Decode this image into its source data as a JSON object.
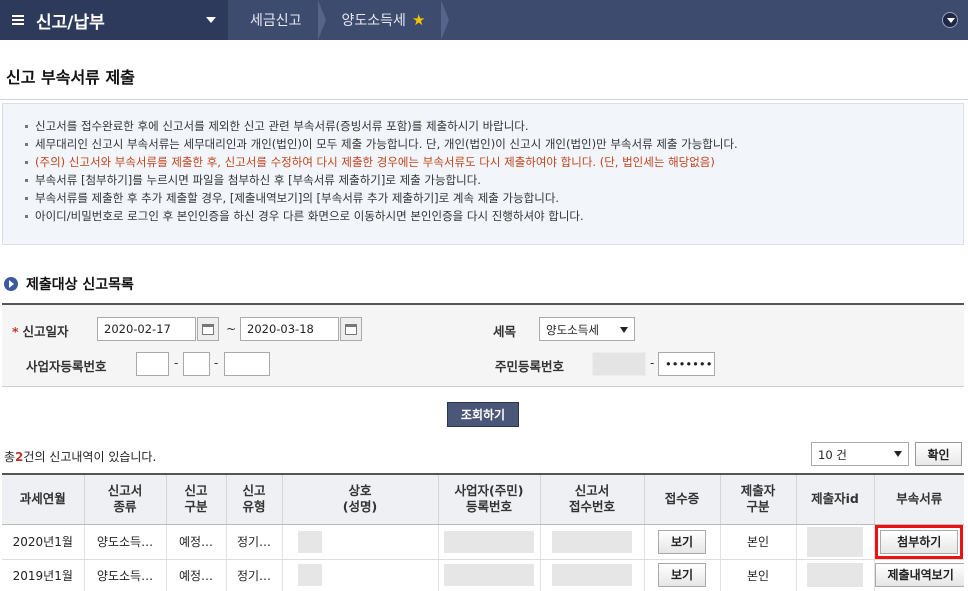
{
  "nav": {
    "main_label": "신고/납부",
    "crumb1": "세금신고",
    "crumb2": "양도소득세",
    "favorite_icon": "star-icon"
  },
  "title": "신고 부속서류 제출",
  "notices": [
    "신고서를 접수완료한 후에 신고서를 제외한 신고 관련 부속서류(증빙서류 포함)를 제출하시기 바랍니다.",
    "세무대리인 신고시 부속서류는 세무대리인과 개인(법인)이 모두 제출 가능합니다. 단, 개인(법인)이 신고시 개인(법인)만 부속서류 제출 가능합니다.",
    "(주의) 신고서와 부속서류를 제출한 후, 신고서를 수정하여 다시 제출한 경우에는 부속서류도 다시 제출하여야 합니다. (단, 법인세는 해당없음)",
    "부속서류 [첨부하기]를 누르시면 파일을 첨부하신 후 [부속서류 제출하기]로 제출 가능합니다.",
    "부속서류를 제출한 후 추가 제출할 경우, [제출내역보기]의 [부속서류 추가 제출하기]로 계속 제출 가능합니다.",
    "아이디/비밀번호로 로그인 후 본인인증을 하신 경우 다른 화면으로 이동하시면 본인인증을 다시 진행하셔야 합니다."
  ],
  "section_title": "제출대상 신고목록",
  "search": {
    "date_label": "신고일자",
    "date_from": "2020-02-17",
    "date_to": "2020-03-18",
    "tilde": "~",
    "tax_label": "세목",
    "tax_value": "양도소득세",
    "bizno_label": "사업자등록번호",
    "rrn_label": "주민등록번호",
    "rrn_masked": "•••••••",
    "dash": "-",
    "button": "조회하기"
  },
  "result": {
    "count_prefix": "총",
    "count": "2",
    "count_suffix": "건의 신고내역이 있습니다.",
    "page_size": "10 건",
    "confirm": "확인"
  },
  "table": {
    "headers": [
      [
        "과세연월",
        ""
      ],
      [
        "신고서",
        "종류"
      ],
      [
        "신고",
        "구분"
      ],
      [
        "신고",
        "유형"
      ],
      [
        "상호",
        "(성명)"
      ],
      [
        "사업자(주민)",
        "등록번호"
      ],
      [
        "신고서",
        "접수번호"
      ],
      [
        "접수증",
        ""
      ],
      [
        "제출자",
        "구분"
      ],
      [
        "제출자id",
        ""
      ],
      [
        "부속서류",
        ""
      ]
    ],
    "rows": [
      {
        "period": "2020년1월",
        "kind": "양도소득…",
        "category": "예정…",
        "type": "정기…",
        "receipt_btn": "보기",
        "submitter": "본인",
        "action": "첨부하기"
      },
      {
        "period": "2019년1월",
        "kind": "양도소득…",
        "category": "예정…",
        "type": "정기…",
        "receipt_btn": "보기",
        "submitter": "본인",
        "action": "제출내역보기"
      }
    ]
  }
}
